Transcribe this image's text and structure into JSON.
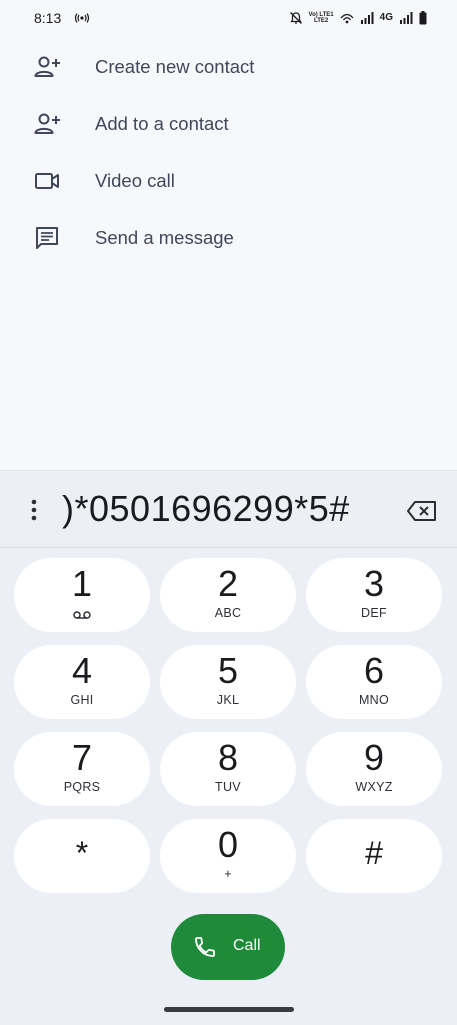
{
  "status_bar": {
    "time": "8:13",
    "volte_top": "Vo) LTE1",
    "volte_bottom": "LTE2",
    "network": "4G"
  },
  "actions": [
    {
      "label": "Create new contact",
      "icon": "person-add-icon"
    },
    {
      "label": "Add to a contact",
      "icon": "person-add-icon"
    },
    {
      "label": "Video call",
      "icon": "videocam-icon"
    },
    {
      "label": "Send a message",
      "icon": "message-icon"
    }
  ],
  "dialer": {
    "number": ")*0501696299*5#"
  },
  "keypad": [
    {
      "digit": "1",
      "letters": ""
    },
    {
      "digit": "2",
      "letters": "ABC"
    },
    {
      "digit": "3",
      "letters": "DEF"
    },
    {
      "digit": "4",
      "letters": "GHI"
    },
    {
      "digit": "5",
      "letters": "JKL"
    },
    {
      "digit": "6",
      "letters": "MNO"
    },
    {
      "digit": "7",
      "letters": "PQRS"
    },
    {
      "digit": "8",
      "letters": "TUV"
    },
    {
      "digit": "9",
      "letters": "WXYZ"
    },
    {
      "digit": "*",
      "letters": ""
    },
    {
      "digit": "0",
      "letters": "+"
    },
    {
      "digit": "#",
      "letters": ""
    }
  ],
  "call_button": {
    "label": "Call"
  },
  "colors": {
    "background": "#f7f8fc",
    "keypad_panel": "#eceff5",
    "key": "#ffffff",
    "call_green": "#1e8a3a",
    "action_text": "#3f4759"
  }
}
